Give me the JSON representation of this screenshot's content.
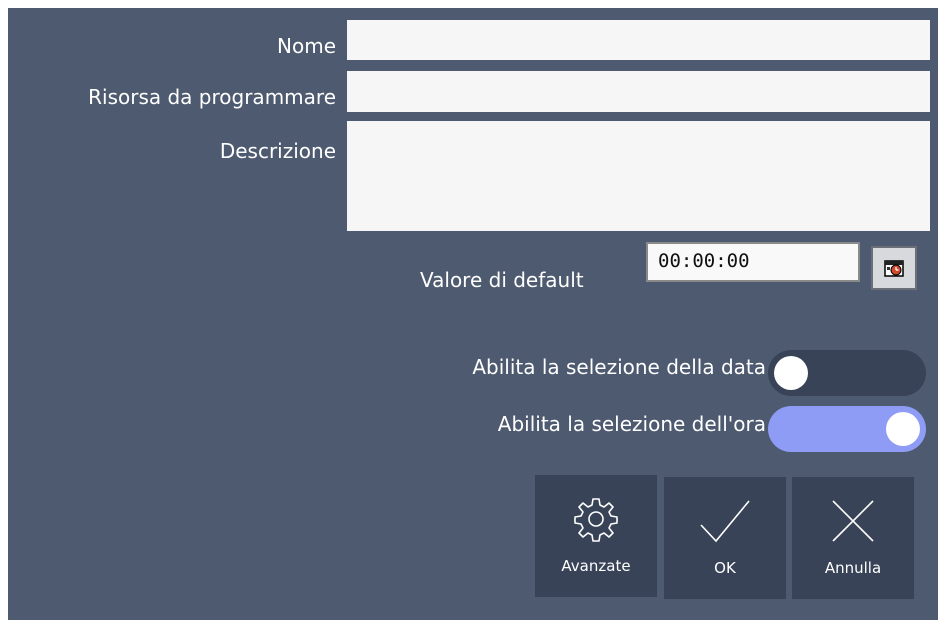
{
  "form": {
    "name_label": "Nome",
    "name_value": "",
    "resource_label": "Risorsa da programmare",
    "resource_value": "",
    "description_label": "Descrizione",
    "description_value": "",
    "default_label": "Valore di default",
    "default_value": "00:00:00",
    "time_picker_icon": "clock-calendar-icon"
  },
  "options": {
    "date_toggle_label": "Abilita la selezione della data",
    "date_toggle_on": false,
    "time_toggle_label": "Abilita la selezione dell'ora",
    "time_toggle_on": true
  },
  "buttons": {
    "advanced_label": "Avanzate",
    "advanced_icon": "gear-icon",
    "ok_label": "OK",
    "ok_icon": "checkmark-icon",
    "cancel_label": "Annulla",
    "cancel_icon": "close-icon"
  },
  "colors": {
    "background": "#4e5a6f",
    "toggle_off": "#394357",
    "toggle_on": "#8e9cf5",
    "button_bg": "#394357"
  }
}
